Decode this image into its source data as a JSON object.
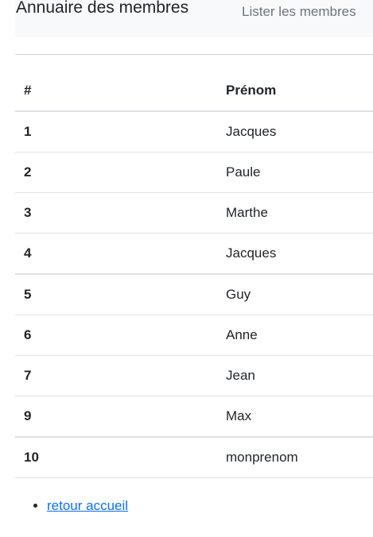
{
  "navbar": {
    "brand": "Annuaire des membres",
    "link_label": "Lister les membres"
  },
  "table": {
    "headers": {
      "num": "#",
      "firstname": "Prénom"
    },
    "rows": [
      {
        "num": "1",
        "firstname": "Jacques"
      },
      {
        "num": "2",
        "firstname": "Paule"
      },
      {
        "num": "3",
        "firstname": "Marthe"
      },
      {
        "num": "4",
        "firstname": "Jacques"
      },
      {
        "num": "5",
        "firstname": "Guy"
      },
      {
        "num": "6",
        "firstname": "Anne"
      },
      {
        "num": "7",
        "firstname": "Jean"
      },
      {
        "num": "9",
        "firstname": "Max"
      },
      {
        "num": "10",
        "firstname": "monprenom"
      }
    ]
  },
  "links": {
    "back_home": "retour accueil"
  }
}
